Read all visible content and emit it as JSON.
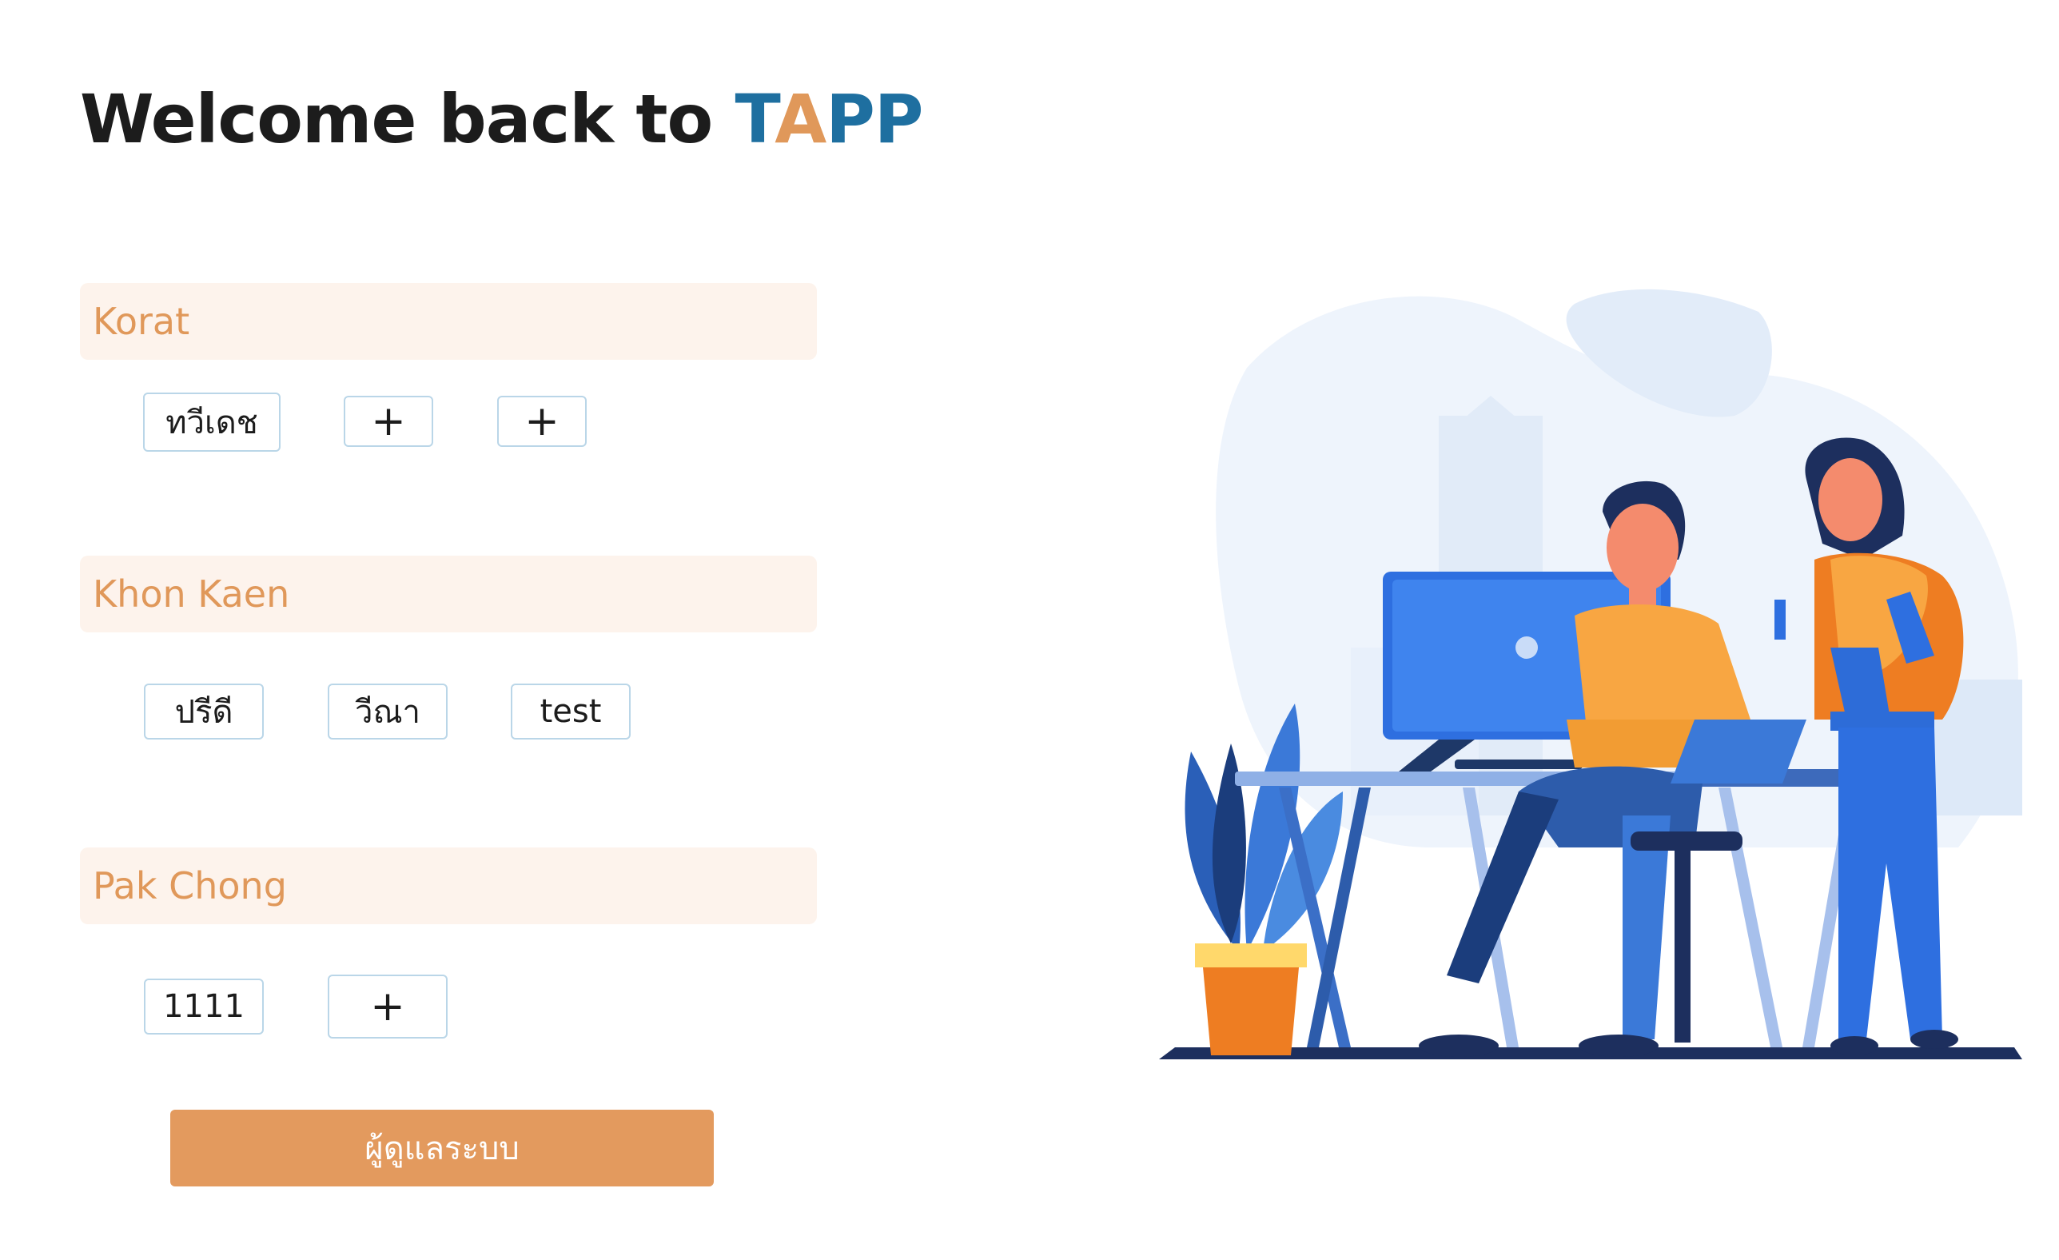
{
  "header": {
    "title_prefix": "Welcome back to ",
    "brand_t": "T",
    "brand_a": "A",
    "brand_pp": "PP"
  },
  "branches": [
    {
      "name": "Korat",
      "users": [
        "ทวีเดช",
        "+",
        "+"
      ]
    },
    {
      "name": "Khon Kaen",
      "users": [
        "ปรีดี",
        "วีณา",
        "test"
      ]
    },
    {
      "name": "Pak Chong",
      "users": [
        "1111",
        "+"
      ]
    }
  ],
  "admin_button": {
    "label": "ผู้ดูแลระบบ"
  },
  "colors": {
    "brand_blue": "#1e6fa0",
    "brand_orange": "#e0985a",
    "bar_bg": "#fdf3ec",
    "button_bg": "#e39a5e",
    "chip_border": "#bad6e8"
  },
  "illustration": {
    "icon": "office-team-illustration"
  }
}
